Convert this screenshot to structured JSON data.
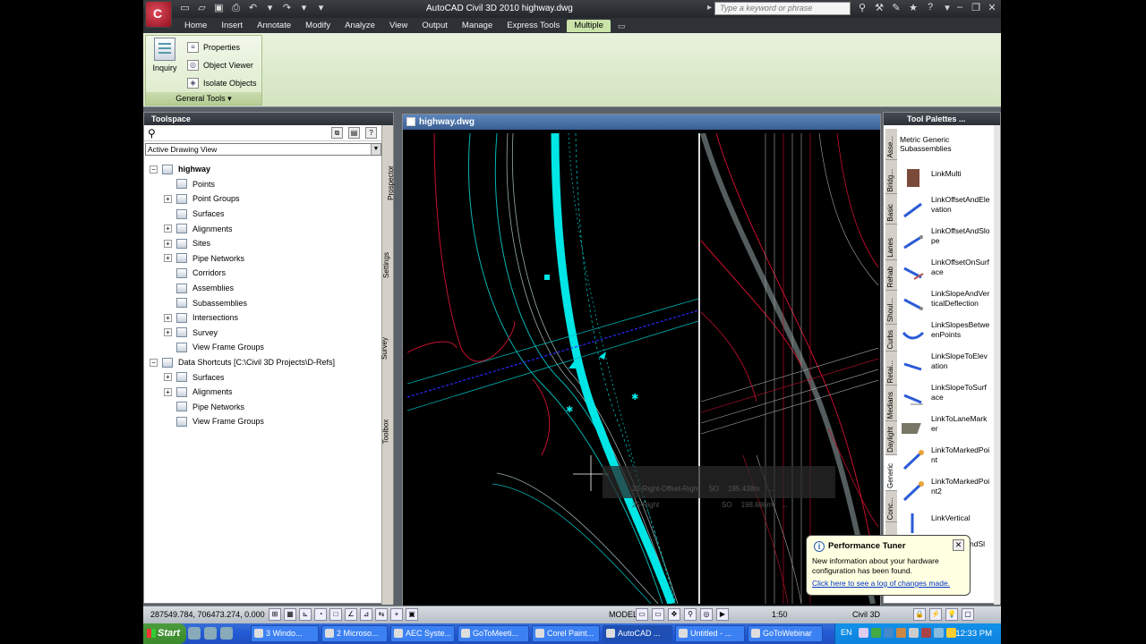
{
  "window": {
    "title": "AutoCAD Civil 3D 2010    highway.dwg",
    "search_placeholder": "Type a keyword or phrase"
  },
  "ribbon": {
    "tabs": [
      "Home",
      "Insert",
      "Annotate",
      "Modify",
      "Analyze",
      "View",
      "Output",
      "Manage",
      "Express Tools",
      "Multiple"
    ],
    "active_tab": "Multiple",
    "panel": {
      "inquiry_label": "Inquiry",
      "tools": [
        "Properties",
        "Object Viewer",
        "Isolate Objects"
      ],
      "footer": "General Tools"
    }
  },
  "toolspace": {
    "title": "Toolspace",
    "view_combo": "Active Drawing View",
    "side_tabs": [
      "Prospector",
      "Settings",
      "Survey",
      "Toolbox"
    ],
    "tree": [
      {
        "label": "highway",
        "level": 0,
        "expander": "−",
        "icon": "drawing-icon",
        "bold": true
      },
      {
        "label": "Points",
        "level": 1,
        "expander": "",
        "icon": "points-icon"
      },
      {
        "label": "Point Groups",
        "level": 1,
        "expander": "+",
        "icon": "point-groups-icon"
      },
      {
        "label": "Surfaces",
        "level": 1,
        "expander": "",
        "icon": "surfaces-icon"
      },
      {
        "label": "Alignments",
        "level": 1,
        "expander": "+",
        "icon": "alignments-icon"
      },
      {
        "label": "Sites",
        "level": 1,
        "expander": "+",
        "icon": "sites-icon"
      },
      {
        "label": "Pipe Networks",
        "level": 1,
        "expander": "+",
        "icon": "pipe-networks-icon"
      },
      {
        "label": "Corridors",
        "level": 1,
        "expander": "",
        "icon": "corridors-icon"
      },
      {
        "label": "Assemblies",
        "level": 1,
        "expander": "",
        "icon": "assemblies-icon"
      },
      {
        "label": "Subassemblies",
        "level": 1,
        "expander": "",
        "icon": "subassemblies-icon"
      },
      {
        "label": "Intersections",
        "level": 1,
        "expander": "+",
        "icon": "intersections-icon"
      },
      {
        "label": "Survey",
        "level": 1,
        "expander": "+",
        "icon": "survey-icon"
      },
      {
        "label": "View Frame Groups",
        "level": 1,
        "expander": "",
        "icon": "view-frame-groups-icon"
      },
      {
        "label": "Data Shortcuts [C:\\Civil 3D Projects\\D-Refs]",
        "level": 0,
        "expander": "−",
        "icon": "data-shortcuts-icon"
      },
      {
        "label": "Surfaces",
        "level": 1,
        "expander": "+",
        "icon": "surfaces-icon"
      },
      {
        "label": "Alignments",
        "level": 1,
        "expander": "+",
        "icon": "alignments-icon"
      },
      {
        "label": "Pipe Networks",
        "level": 1,
        "expander": "",
        "icon": "pipe-networks-icon"
      },
      {
        "label": "View Frame Groups",
        "level": 1,
        "expander": "",
        "icon": "view-frame-groups-icon"
      }
    ]
  },
  "drawing": {
    "title": "highway.dwg",
    "tooltip_rows": [
      {
        "name": "25-Right-Offset-Right",
        "code": "SO",
        "value": "195.438m",
        "extra": "..."
      },
      {
        "name": "25-Right",
        "code": "SO",
        "value": "198.686m",
        "extra": "..."
      }
    ]
  },
  "tool_palettes": {
    "title": "Tool Palettes ...",
    "vertical_tabs": [
      "Asse...",
      "Bridg...",
      "Basic",
      "Lanes",
      "Rehab",
      "Shoul...",
      "Curbs",
      "Retai...",
      "Medians",
      "Daylight",
      "Generic",
      "Conc..."
    ],
    "selected_tab": "Generic",
    "heading": "Metric Generic Subassemblies",
    "items": [
      {
        "label": "LinkMulti",
        "icon": "link-multi-icon"
      },
      {
        "label": "LinkOffsetAndElevation",
        "icon": "link-offset-elevation-icon"
      },
      {
        "label": "LinkOffsetAndSlope",
        "icon": "link-offset-slope-icon"
      },
      {
        "label": "LinkOffsetOnSurface",
        "icon": "link-offset-surface-icon"
      },
      {
        "label": "LinkSlopeAndVerticalDeflection",
        "icon": "link-slope-deflection-icon"
      },
      {
        "label": "LinkSlopesBetweenPoints",
        "icon": "link-slopes-points-icon"
      },
      {
        "label": "LinkSlopeToElevation",
        "icon": "link-slope-elevation-icon"
      },
      {
        "label": "LinkSlopeToSurface",
        "icon": "link-slope-surface-icon"
      },
      {
        "label": "LinkToLaneMarker",
        "icon": "link-lane-marker-icon"
      },
      {
        "label": "LinkToMarkedPoint",
        "icon": "link-marked-point-icon"
      },
      {
        "label": "LinkToMarkedPoint2",
        "icon": "link-marked-point2-icon"
      },
      {
        "label": "LinkVertical",
        "icon": "link-vertical-icon"
      },
      {
        "label": "LinkWidthAndSl",
        "icon": "link-width-slope-icon"
      }
    ]
  },
  "balloon": {
    "title": "Performance Tuner",
    "text": "New information about your hardware configuration has been found.",
    "link": "Click here to see a log of changes made."
  },
  "status_bar": {
    "coordinates": "287549.784, 706473.274, 0.000",
    "model": "MODEL",
    "scale": "1:50",
    "workspace": "Civil 3D"
  },
  "taskbar": {
    "start": "Start",
    "buttons": [
      "3 Windo...",
      "2 Microso...",
      "AEC Syste...",
      "GoToMeeti...",
      "Corel Paint...",
      "AutoCAD ...",
      "Untitled - ...",
      "GoToWebinar"
    ],
    "active_button": "AutoCAD ...",
    "language": "EN",
    "clock": "12:33 PM"
  },
  "colors": {
    "ribbon_green": "#c9e3a9",
    "alignment_cyan": "#00e5e5",
    "road_red": "#c8102e",
    "profile_blue": "#2b2bff"
  }
}
